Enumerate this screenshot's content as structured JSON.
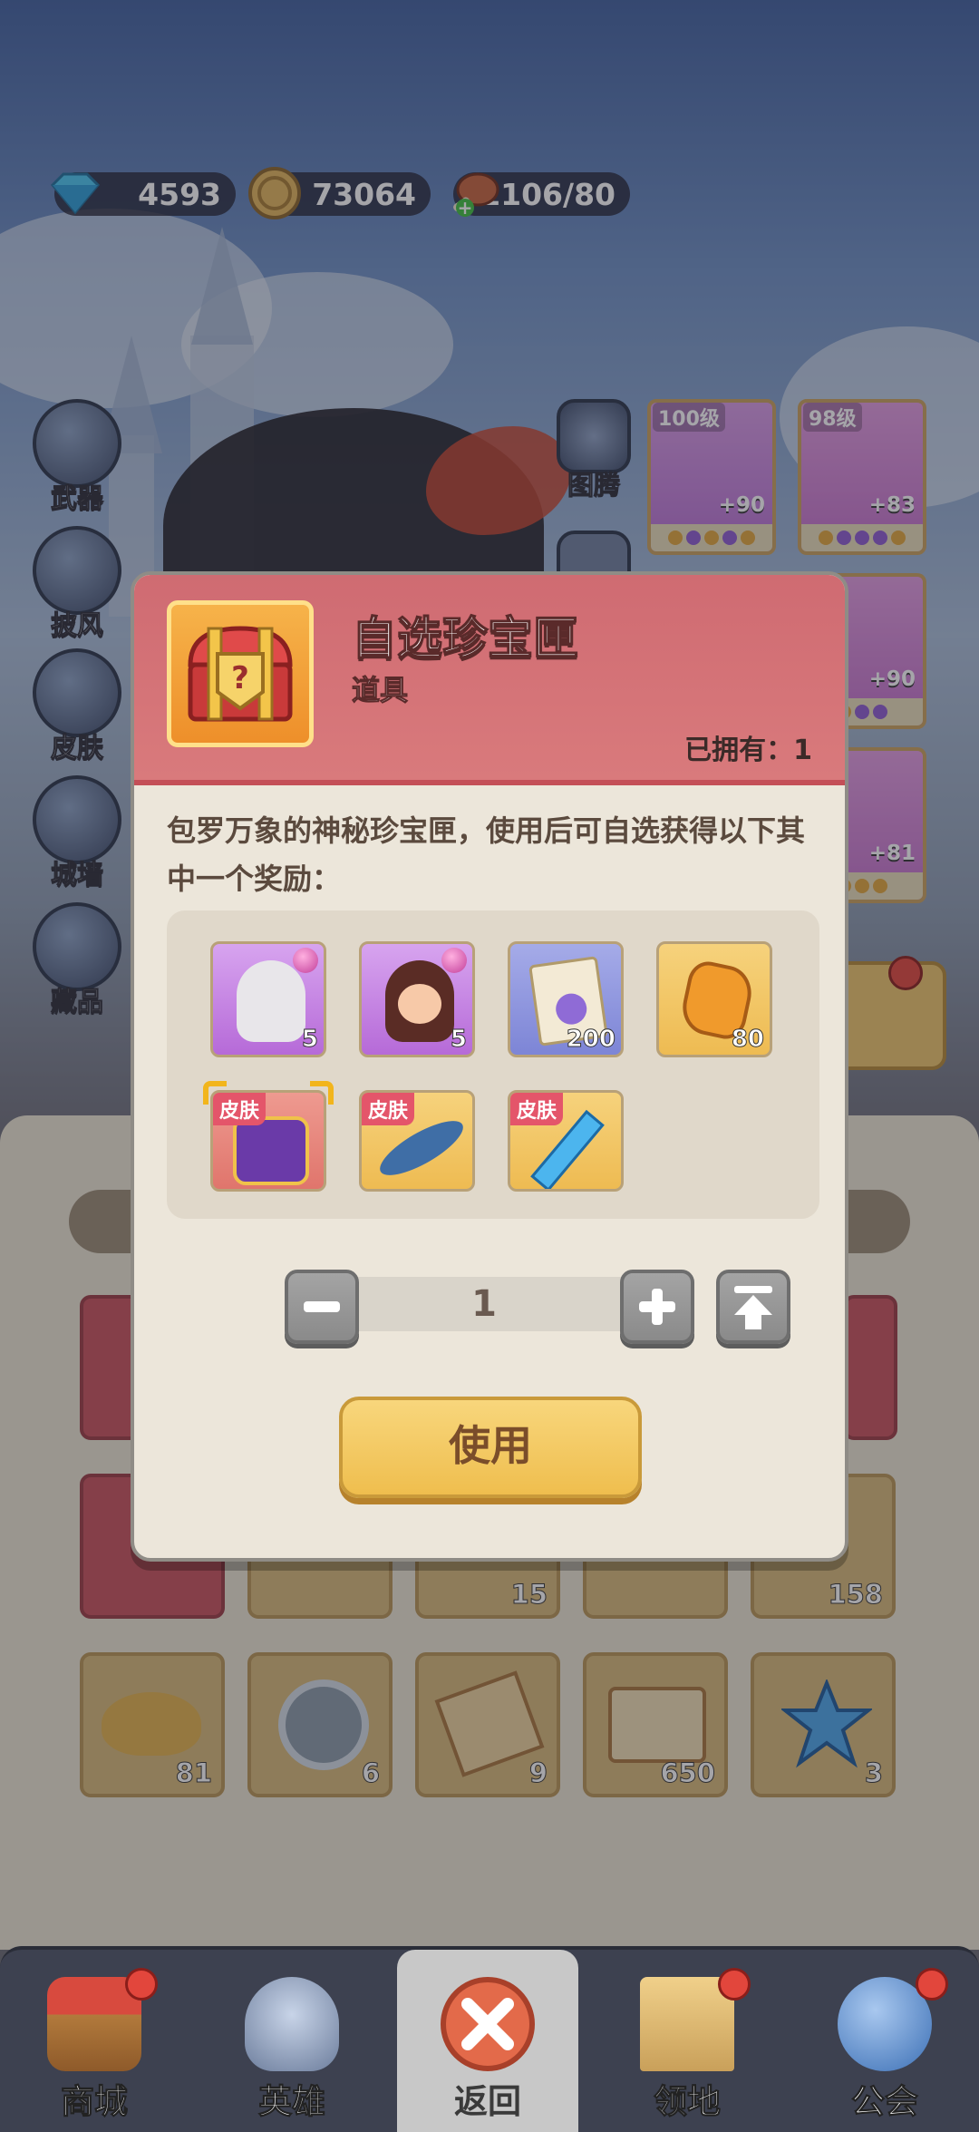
{
  "resources": {
    "diamonds": "4593",
    "gold": "73064",
    "food": "1106/80"
  },
  "side_menu": [
    {
      "label": "武器"
    },
    {
      "label": "披风"
    },
    {
      "label": "皮肤"
    },
    {
      "label": "城墙"
    },
    {
      "label": "藏品"
    }
  ],
  "totem": {
    "label": "图腾"
  },
  "equipment": [
    {
      "level": "100级",
      "bonus": "+90"
    },
    {
      "level": "98级",
      "bonus": "+83"
    },
    {
      "bonus": "+90"
    },
    {
      "bonus": "+81"
    }
  ],
  "background_items": [
    {
      "count": "15"
    },
    {
      "count": "158"
    },
    {
      "count": "81"
    },
    {
      "count": "6"
    },
    {
      "count": "9"
    },
    {
      "count": "650"
    },
    {
      "count": "3"
    }
  ],
  "modal": {
    "title": "自选珍宝匣",
    "type": "道具",
    "owned": "已拥有：1",
    "description": "包罗万象的神秘珍宝匣，使用后可自选获得以下其中一个奖励：",
    "rewards": [
      {
        "name": "hero-shard-white-hair",
        "count": "5",
        "color": "#c58ee6"
      },
      {
        "name": "hero-shard-girl",
        "count": "5",
        "color": "#c58ee6"
      },
      {
        "name": "integral-scroll",
        "count": "200",
        "color": "#9aa2e4"
      },
      {
        "name": "amber-stone",
        "count": "80",
        "color": "#f1c86a"
      },
      {
        "name": "skin-purple-chest",
        "tag": "皮肤",
        "color": "#e98780"
      },
      {
        "name": "skin-swordfish",
        "tag": "皮肤",
        "color": "#f1c86a"
      },
      {
        "name": "skin-crystal-sword",
        "tag": "皮肤",
        "color": "#f1c86a"
      }
    ],
    "quantity": "1",
    "use_label": "使用"
  },
  "bottom_nav": [
    {
      "label": "商城",
      "badge": true
    },
    {
      "label": "英雄",
      "badge": false
    },
    {
      "label": "返回",
      "badge": false
    },
    {
      "label": "领地",
      "badge": true
    },
    {
      "label": "公会",
      "badge": true
    }
  ]
}
